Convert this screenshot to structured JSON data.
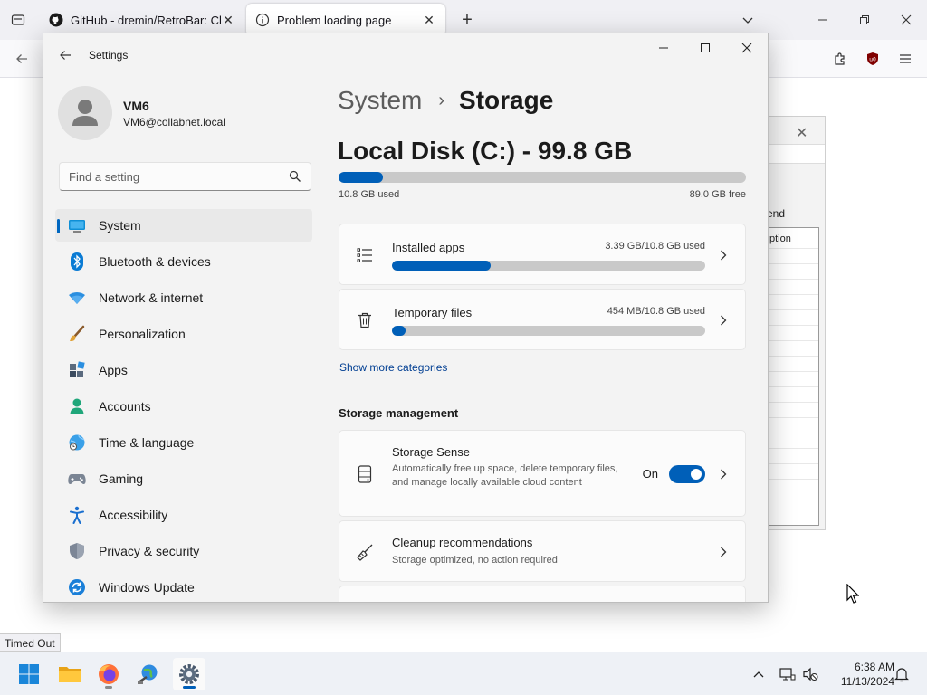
{
  "browser": {
    "tabs": [
      {
        "title": "GitHub - dremin/RetroBar: Cla",
        "icon": "github-icon"
      },
      {
        "title": "Problem loading page",
        "icon": "info-icon"
      }
    ],
    "status_text": "Timed Out"
  },
  "background_dialog": {
    "label": "end",
    "list_header": "ption"
  },
  "settings": {
    "window_title": "Settings",
    "user": {
      "name": "VM6",
      "email": "VM6@collabnet.local"
    },
    "search": {
      "placeholder": "Find a setting"
    },
    "nav": [
      {
        "label": "System",
        "icon": "monitor-icon",
        "active": true
      },
      {
        "label": "Bluetooth & devices",
        "icon": "bluetooth-icon"
      },
      {
        "label": "Network & internet",
        "icon": "wifi-icon"
      },
      {
        "label": "Personalization",
        "icon": "brush-icon"
      },
      {
        "label": "Apps",
        "icon": "apps-icon"
      },
      {
        "label": "Accounts",
        "icon": "person-icon"
      },
      {
        "label": "Time & language",
        "icon": "globe-clock-icon"
      },
      {
        "label": "Gaming",
        "icon": "gamepad-icon"
      },
      {
        "label": "Accessibility",
        "icon": "accessibility-icon"
      },
      {
        "label": "Privacy & security",
        "icon": "shield-icon"
      },
      {
        "label": "Windows Update",
        "icon": "update-icon"
      }
    ],
    "breadcrumb": {
      "parent": "System",
      "separator": "›",
      "current": "Storage"
    },
    "disk": {
      "title": "Local Disk (C:) - 99.8 GB",
      "used_label": "10.8 GB used",
      "free_label": "89.0 GB free",
      "used_fraction": 0.108
    },
    "categories": [
      {
        "title": "Installed apps",
        "meta": "3.39 GB/10.8 GB used",
        "fraction": 0.314,
        "icon": "list-icon"
      },
      {
        "title": "Temporary files",
        "meta": "454 MB/10.8 GB used",
        "fraction": 0.042,
        "icon": "trash-icon"
      }
    ],
    "show_more": "Show more categories",
    "management": {
      "heading": "Storage management",
      "storage_sense": {
        "title": "Storage Sense",
        "description": "Automatically free up space, delete temporary files, and manage locally available cloud content",
        "toggle_label": "On",
        "toggle_on": true
      },
      "cleanup": {
        "title": "Cleanup recommendations",
        "description": "Storage optimized, no action required"
      }
    }
  },
  "taskbar": {
    "apps": [
      "start-icon",
      "file-explorer-icon",
      "firefox-icon",
      "network-globe-icon",
      "settings-gear-icon"
    ],
    "clock": {
      "time": "6:38 AM",
      "date": "11/13/2024"
    }
  },
  "colors": {
    "accent": "#005fb8",
    "track": "#c9c9c9"
  }
}
